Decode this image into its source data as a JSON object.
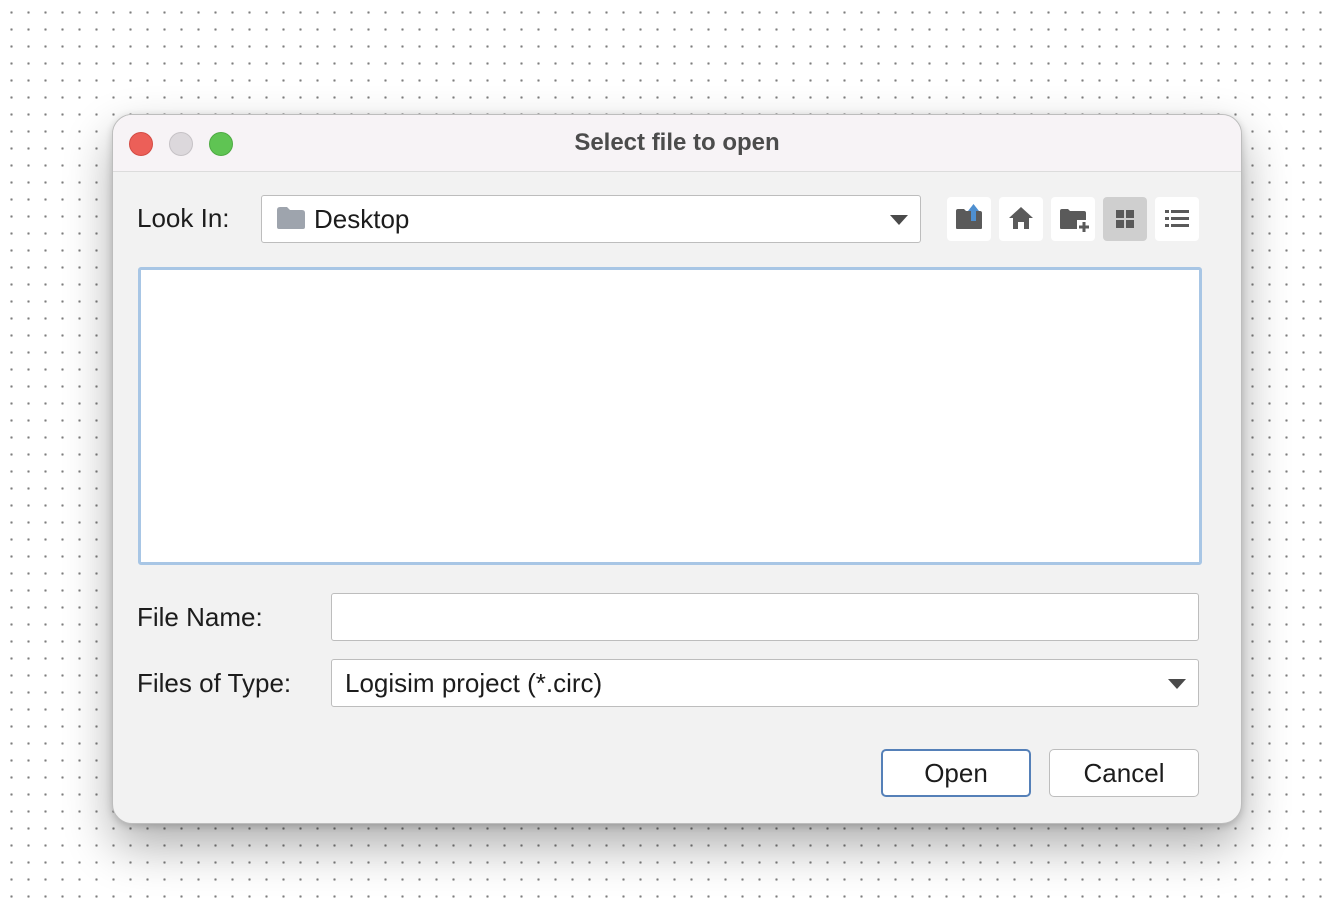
{
  "dialog": {
    "title": "Select file to open"
  },
  "look_in": {
    "label": "Look In:",
    "value": "Desktop"
  },
  "toolbar": {
    "icons": [
      "up-folder-icon",
      "home-icon",
      "new-folder-icon",
      "grid-view-icon",
      "list-view-icon"
    ],
    "selected_view": "grid-view"
  },
  "file_name": {
    "label": "File Name:",
    "value": ""
  },
  "file_type": {
    "label": "Files of Type:",
    "value": "Logisim project (*.circ)"
  },
  "buttons": {
    "open": "Open",
    "cancel": "Cancel"
  },
  "colors": {
    "close": "#ec5f58",
    "minimize": "#dcd8dc",
    "zoom": "#5fc453",
    "focus_ring": "#a8c6e5",
    "default_button_border": "#5580b8",
    "folder": "#9ea4ad",
    "upload_arrow": "#4e8fd0"
  }
}
